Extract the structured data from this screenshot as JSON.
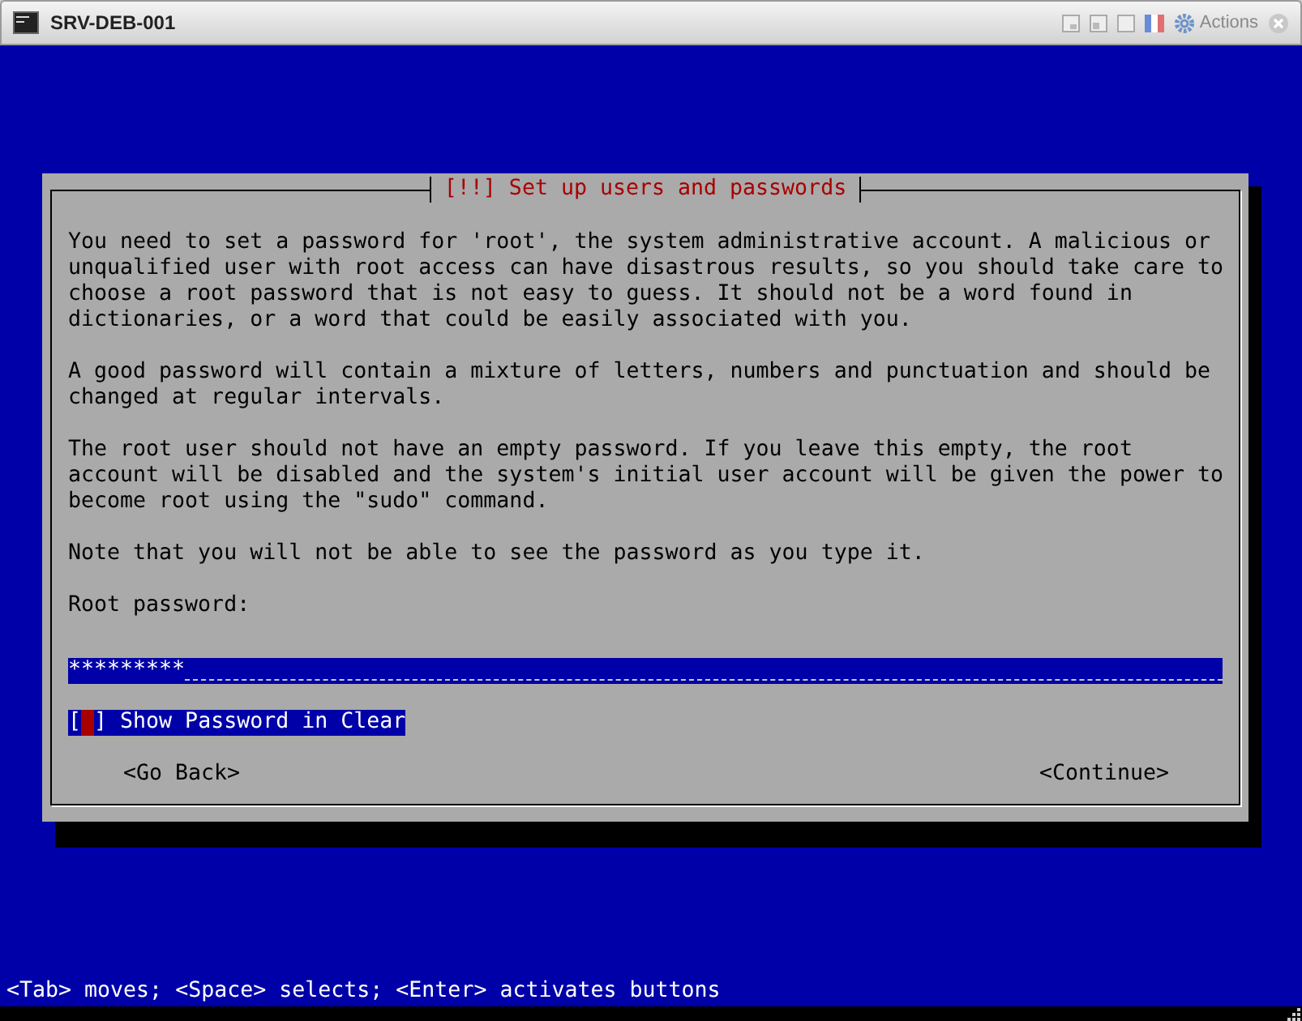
{
  "window": {
    "title": "SRV-DEB-001",
    "actions": "Actions"
  },
  "dialog": {
    "title": "[!!] Set up users and passwords",
    "paragraphs": [
      "You need to set a password for 'root', the system administrative account. A malicious or unqualified user with root access can have disastrous results, so you should take care to choose a root password that is not easy to guess. It should not be a word found in dictionaries, or a word that could be easily associated with you.",
      "A good password will contain a mixture of letters, numbers and punctuation and should be changed at regular intervals.",
      "The root user should not have an empty password. If you leave this empty, the root account will be disabled and the system's initial user account will be given the power to become root using the \"sudo\" command.",
      "Note that you will not be able to see the password as you type it."
    ],
    "field_label": "Root password:",
    "password": {
      "value": "*********"
    },
    "checkbox": {
      "open_bracket": "[",
      "close_bracket": "]",
      "label": "Show Password in Clear",
      "checked": false,
      "focused": true
    },
    "buttons": [
      "<Go Back>",
      "<Continue>"
    ]
  },
  "status_bar": "<Tab> moves; <Space> selects; <Enter> activates buttons"
}
